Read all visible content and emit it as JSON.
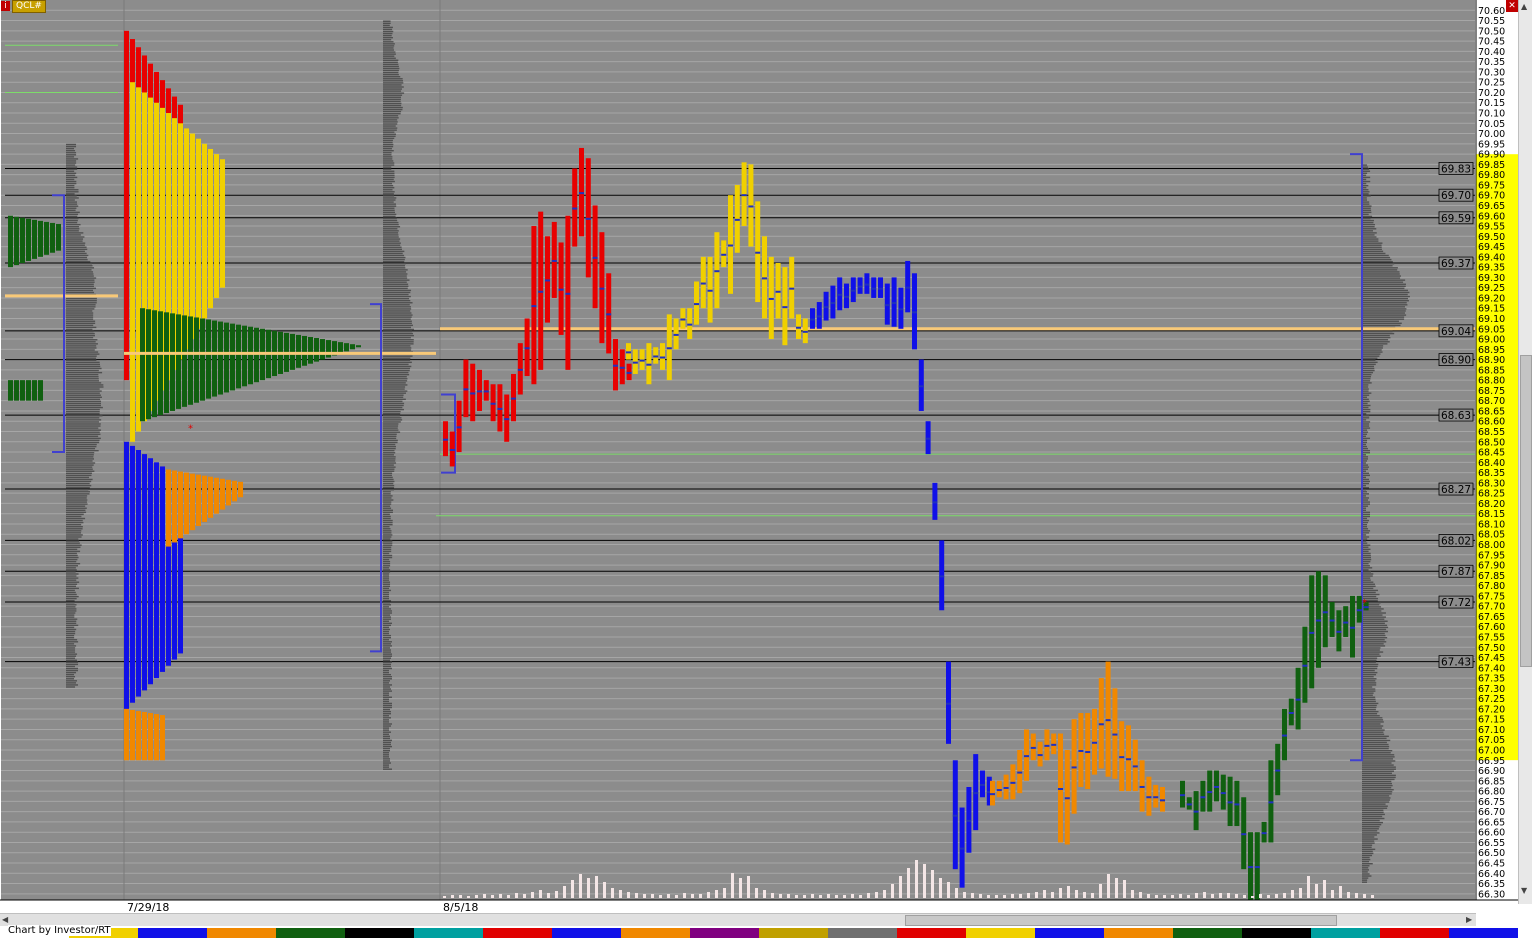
{
  "window": {
    "symbol_label": "QCL#",
    "corner_icon_left": "info-icon",
    "corner_icon_right": "close-icon",
    "footer_credit": "Chart by Investor/RT"
  },
  "colors": {
    "background": "#8c8c8c",
    "price_panel_bg": "#ffffff",
    "grid_line": "#a6a6a6",
    "ref_line": "#000000",
    "poc_line": "#f8c978",
    "green_line": "#7ddc6a",
    "blue_bracket": "#4040d0",
    "period_colors": [
      "#e80000",
      "#f0d000",
      "#e8e8e8",
      "#1010e8",
      "#f08800",
      "#106010"
    ]
  },
  "chart_data": {
    "type": "bar",
    "title": "",
    "xlabel": "",
    "ylabel": "",
    "ylim": [
      66.27,
      70.65
    ],
    "y_tick_step": 0.05,
    "y_tick_range": [
      66.3,
      70.6
    ],
    "grid": true,
    "x_labels": [
      "7/29/18",
      "8/5/18"
    ],
    "reference_levels": [
      69.83,
      69.7,
      69.59,
      69.37,
      69.04,
      68.9,
      68.63,
      68.27,
      68.02,
      67.87,
      67.72,
      67.43
    ],
    "poc_levels": [
      69.21,
      68.93,
      69.05
    ],
    "green_levels": [
      70.43,
      70.2,
      68.44,
      68.14
    ],
    "value_area_highlight": [
      66.95,
      69.9
    ],
    "last_price": 67.72,
    "brackets": [
      {
        "high": 69.7,
        "low": 68.45
      },
      {
        "high": 69.17,
        "low": 67.48
      },
      {
        "high": 68.73,
        "low": 68.35
      },
      {
        "high": 69.9,
        "low": 66.95
      }
    ],
    "bars": {
      "red": [
        [
          68.6,
          68.43
        ],
        [
          68.55,
          68.38
        ],
        [
          68.7,
          68.45
        ],
        [
          68.9,
          68.62
        ],
        [
          68.88,
          68.6
        ],
        [
          68.85,
          68.65
        ],
        [
          68.8,
          68.7
        ],
        [
          68.78,
          68.6
        ],
        [
          68.78,
          68.55
        ],
        [
          68.73,
          68.5
        ],
        [
          68.83,
          68.6
        ],
        [
          68.98,
          68.73
        ],
        [
          69.1,
          68.82
        ],
        [
          69.55,
          68.78
        ],
        [
          69.62,
          68.85
        ],
        [
          69.5,
          69.08
        ],
        [
          69.57,
          69.2
        ],
        [
          69.47,
          69.02
        ],
        [
          69.6,
          68.85
        ],
        [
          69.83,
          69.45
        ],
        [
          69.93,
          69.5
        ],
        [
          69.88,
          69.3
        ],
        [
          69.65,
          69.15
        ],
        [
          69.52,
          68.98
        ],
        [
          69.32,
          68.93
        ],
        [
          69.0,
          68.75
        ],
        [
          68.95,
          68.78
        ],
        [
          68.88,
          68.8
        ]
      ],
      "yellow": [
        [
          68.98,
          68.9
        ],
        [
          68.95,
          68.83
        ],
        [
          68.95,
          68.85
        ],
        [
          68.98,
          68.78
        ],
        [
          68.96,
          68.88
        ],
        [
          68.98,
          68.85
        ],
        [
          69.12,
          68.8
        ],
        [
          69.1,
          68.95
        ],
        [
          69.15,
          69.05
        ],
        [
          69.15,
          69.0
        ],
        [
          69.28,
          69.07
        ],
        [
          69.4,
          69.15
        ],
        [
          69.4,
          69.08
        ],
        [
          69.52,
          69.15
        ],
        [
          69.48,
          69.35
        ],
        [
          69.7,
          69.22
        ],
        [
          69.75,
          69.42
        ],
        [
          69.86,
          69.55
        ],
        [
          69.85,
          69.45
        ],
        [
          69.67,
          69.18
        ],
        [
          69.5,
          69.1
        ],
        [
          69.4,
          69.0
        ],
        [
          69.37,
          69.1
        ],
        [
          69.35,
          68.97
        ],
        [
          69.4,
          69.1
        ],
        [
          69.12,
          69.0
        ],
        [
          69.1,
          68.98
        ]
      ],
      "blue": [
        [
          69.15,
          69.05
        ],
        [
          69.18,
          69.05
        ],
        [
          69.23,
          69.09
        ],
        [
          69.26,
          69.1
        ],
        [
          69.3,
          69.14
        ],
        [
          69.27,
          69.15
        ],
        [
          69.3,
          69.18
        ],
        [
          69.3,
          69.22
        ],
        [
          69.32,
          69.22
        ],
        [
          69.3,
          69.2
        ],
        [
          69.3,
          69.2
        ],
        [
          69.27,
          69.07
        ],
        [
          69.3,
          69.06
        ],
        [
          69.25,
          69.05
        ],
        [
          69.38,
          69.13
        ],
        [
          69.32,
          68.95
        ],
        [
          68.9,
          68.65
        ],
        [
          68.6,
          68.44
        ],
        [
          68.3,
          68.12
        ],
        [
          68.02,
          67.68
        ],
        [
          67.43,
          67.03
        ],
        [
          66.95,
          66.42
        ],
        [
          66.72,
          66.33
        ],
        [
          66.82,
          66.5
        ],
        [
          66.98,
          66.61
        ],
        [
          66.9,
          66.77
        ],
        [
          66.87,
          66.73
        ]
      ],
      "orange": [
        [
          66.85,
          66.73
        ],
        [
          66.85,
          66.77
        ],
        [
          66.88,
          66.76
        ],
        [
          66.93,
          66.76
        ],
        [
          67.0,
          66.79
        ],
        [
          67.1,
          66.85
        ],
        [
          67.08,
          66.95
        ],
        [
          67.04,
          66.92
        ],
        [
          67.1,
          66.95
        ],
        [
          67.08,
          66.98
        ],
        [
          67.08,
          66.55
        ],
        [
          67.0,
          66.54
        ],
        [
          67.15,
          66.69
        ],
        [
          67.18,
          66.82
        ],
        [
          67.18,
          66.81
        ],
        [
          67.2,
          66.88
        ],
        [
          67.35,
          66.91
        ],
        [
          67.43,
          66.87
        ],
        [
          67.3,
          66.86
        ],
        [
          67.14,
          66.8
        ],
        [
          67.12,
          66.8
        ],
        [
          67.05,
          66.8
        ],
        [
          66.95,
          66.7
        ],
        [
          66.87,
          66.68
        ],
        [
          66.83,
          66.72
        ],
        [
          66.82,
          66.7
        ]
      ],
      "green": [
        [
          66.85,
          66.72
        ],
        [
          66.77,
          66.71
        ],
        [
          66.8,
          66.61
        ],
        [
          66.85,
          66.7
        ],
        [
          66.9,
          66.7
        ],
        [
          66.9,
          66.75
        ],
        [
          66.88,
          66.71
        ],
        [
          66.87,
          66.63
        ],
        [
          66.85,
          66.63
        ],
        [
          66.77,
          66.42
        ],
        [
          66.6,
          66.27
        ],
        [
          66.6,
          66.27
        ],
        [
          66.65,
          66.55
        ],
        [
          66.95,
          66.55
        ],
        [
          67.03,
          66.78
        ],
        [
          67.2,
          66.95
        ],
        [
          67.25,
          67.12
        ],
        [
          67.4,
          67.1
        ],
        [
          67.6,
          67.23
        ],
        [
          67.85,
          67.3
        ],
        [
          67.87,
          67.4
        ],
        [
          67.85,
          67.5
        ],
        [
          67.72,
          67.55
        ],
        [
          67.68,
          67.48
        ],
        [
          67.7,
          67.55
        ],
        [
          67.75,
          67.45
        ],
        [
          67.75,
          67.62
        ],
        [
          67.72,
          67.68
        ]
      ]
    },
    "volume": [
      2,
      3,
      3,
      2,
      3,
      4,
      3,
      4,
      3,
      5,
      4,
      6,
      8,
      5,
      7,
      12,
      18,
      24,
      20,
      22,
      16,
      10,
      8,
      6,
      5,
      4,
      4,
      3,
      4,
      3,
      5,
      4,
      4,
      6,
      8,
      10,
      25,
      20,
      22,
      10,
      8,
      5,
      4,
      4,
      3,
      3,
      4,
      3,
      4,
      3,
      3,
      4,
      3,
      5,
      6,
      8,
      14,
      22,
      30,
      38,
      34,
      28,
      20,
      16,
      10,
      6,
      5,
      4,
      3,
      3,
      3,
      4,
      4,
      5,
      6,
      8,
      6,
      10,
      12,
      8,
      6,
      5,
      14,
      24,
      20,
      18,
      8,
      6,
      4,
      3,
      3,
      3,
      4,
      3,
      5,
      6,
      4,
      5,
      5,
      4,
      3,
      2,
      4,
      3,
      4,
      5,
      8,
      10,
      22,
      14,
      18,
      8,
      12,
      6,
      5,
      4,
      3
    ]
  }
}
